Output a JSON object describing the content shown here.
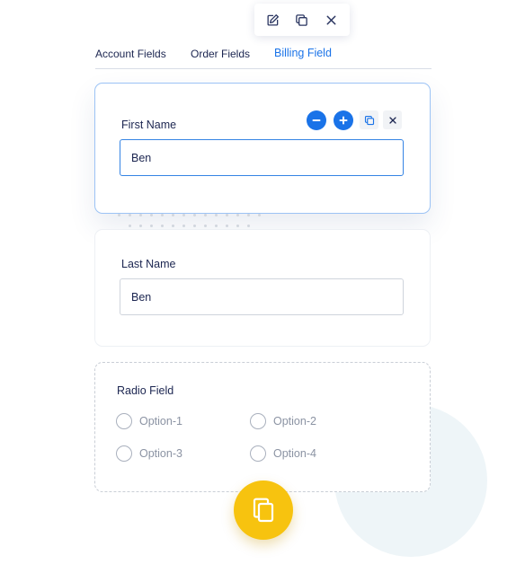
{
  "toolbar": {
    "icons": [
      "edit-icon",
      "copy-icon",
      "close-icon"
    ]
  },
  "tabs": [
    {
      "label": "Account Fields",
      "active": false
    },
    {
      "label": "Order Fields",
      "active": false
    },
    {
      "label": "Billing Field",
      "active": true
    }
  ],
  "first_name": {
    "label": "First Name",
    "value": "Ben",
    "controls": [
      "minus-icon",
      "plus-icon",
      "copy-icon",
      "close-icon"
    ]
  },
  "last_name": {
    "label": "Last Name",
    "value": "Ben"
  },
  "radio_field": {
    "label": "Radio Field",
    "options": [
      "Option-1",
      "Option-2",
      "Option-3",
      "Option-4"
    ]
  },
  "fab": {
    "icon": "copy-icon"
  },
  "colors": {
    "accent": "#1a73e8",
    "fab": "#f7c30f",
    "text": "#1b2550",
    "muted": "#8b93a3"
  }
}
